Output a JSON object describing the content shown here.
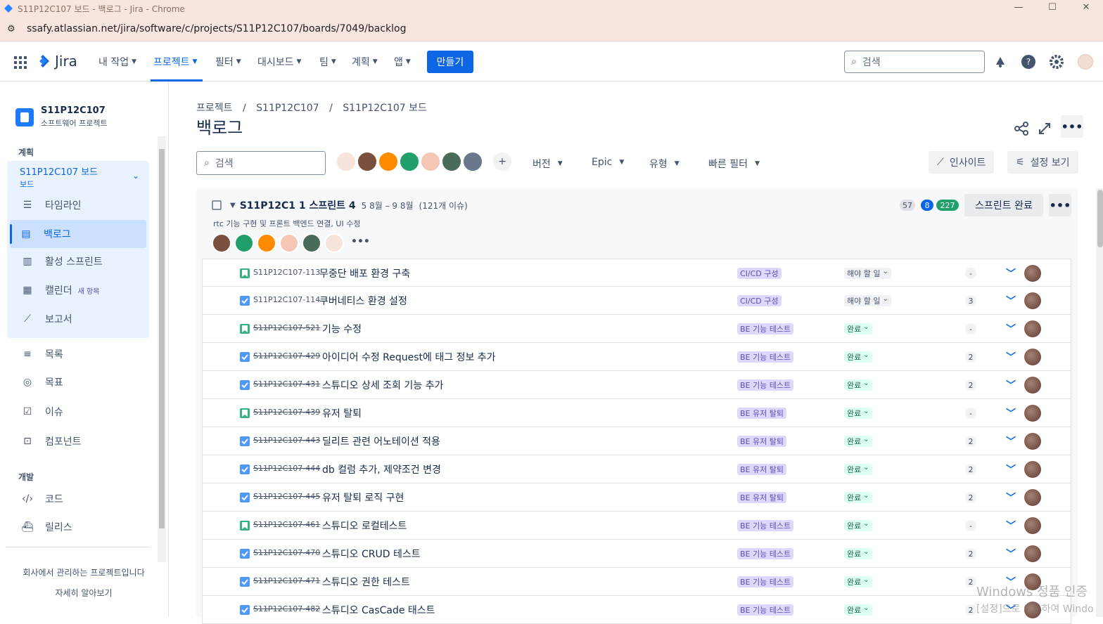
{
  "window": {
    "title": "S11P12C107 보드 - 백로그 - Jira - Chrome"
  },
  "browser": {
    "url": "ssafy.atlassian.net/jira/software/c/projects/S11P12C107/boards/7049/backlog"
  },
  "topnav": {
    "logo": "Jira",
    "items": [
      "내 작업",
      "프로젝트",
      "필터",
      "대시보드",
      "팀",
      "계획",
      "앱"
    ],
    "create_label": "만들기",
    "search_placeholder": "검색"
  },
  "sidebar": {
    "project_name": "S11P12C107",
    "project_type": "소프트웨어 프로젝트",
    "section_plan": "계획",
    "board_name": "S11P12C107 보드",
    "board_sub": "보드",
    "plan_items": [
      "타임라인",
      "백로그",
      "활성 스프린트",
      "캘린더",
      "보고서"
    ],
    "new_tag": "새 항목",
    "other_items": [
      "목록",
      "목표",
      "이슈",
      "컴포넌트"
    ],
    "section_dev": "개발",
    "dev_items": [
      "코드",
      "릴리스"
    ],
    "footer_line1": "회사에서 관리하는 프로젝트입니다",
    "footer_line2": "자세히 알아보기"
  },
  "main": {
    "breadcrumb": [
      "프로젝트",
      "/",
      "S11P12C107",
      "/",
      "S11P12C107 보드"
    ],
    "title": "백로그",
    "search_placeholder": "검색",
    "filters": [
      "버전",
      "Epic",
      "유형",
      "빠른 필터"
    ],
    "insight_label": "인사이트",
    "view_settings_label": "설정 보기"
  },
  "sprint": {
    "name": "S11P12C1 1 스프린트 4",
    "dates": "5 8월 – 9 8월",
    "count": "(121개 이슈)",
    "description": "rtc 기능 구현 및 프론트 백엔드 연결, UI 수정",
    "todo_count": "57",
    "inprogress_count": "8",
    "done_count": "227",
    "complete_label": "스프린트 완료"
  },
  "issues": [
    {
      "key": "S11P12C107-113",
      "type": "story",
      "done": false,
      "summary": "무중단 배포 환경 구축",
      "epic": "CI/CD 구성",
      "status": "해야 할 일",
      "estimate": "-"
    },
    {
      "key": "S11P12C107-114",
      "type": "task",
      "done": false,
      "summary": "쿠버네티스 환경 설정",
      "epic": "CI/CD 구성",
      "status": "해야 할 일",
      "estimate": "3"
    },
    {
      "key": "S11P12C107-521",
      "type": "story",
      "done": true,
      "summary": "기능 수정",
      "epic": "BE 기능 테스트",
      "status": "완료",
      "estimate": "-"
    },
    {
      "key": "S11P12C107-429",
      "type": "task",
      "done": true,
      "summary": "아이디어 수정 Request에 태그 정보 추가",
      "epic": "BE 기능 테스트",
      "status": "완료",
      "estimate": "2"
    },
    {
      "key": "S11P12C107-431",
      "type": "task",
      "done": true,
      "summary": "스튜디오 상세 조회 기능 추가",
      "epic": "BE 기능 테스트",
      "status": "완료",
      "estimate": "2"
    },
    {
      "key": "S11P12C107-439",
      "type": "story",
      "done": true,
      "summary": "유저 탈퇴",
      "epic": "BE 유저 탈퇴",
      "status": "완료",
      "estimate": "-"
    },
    {
      "key": "S11P12C107-443",
      "type": "task",
      "done": true,
      "summary": "딜리트 관련 어노테이션 적용",
      "epic": "BE 유저 탈퇴",
      "status": "완료",
      "estimate": "2"
    },
    {
      "key": "S11P12C107-444",
      "type": "task",
      "done": true,
      "summary": "db 컬럼 추가, 제약조건 변경",
      "epic": "BE 유저 탈퇴",
      "status": "완료",
      "estimate": "2"
    },
    {
      "key": "S11P12C107-445",
      "type": "task",
      "done": true,
      "summary": "유저 탈퇴 로직 구현",
      "epic": "BE 유저 탈퇴",
      "status": "완료",
      "estimate": "2"
    },
    {
      "key": "S11P12C107-461",
      "type": "story",
      "done": true,
      "summary": "스튜디오 로컬테스트",
      "epic": "BE 기능 테스트",
      "status": "완료",
      "estimate": "-"
    },
    {
      "key": "S11P12C107-470",
      "type": "task",
      "done": true,
      "summary": "스튜디오 CRUD 테스트",
      "epic": "BE 기능 테스트",
      "status": "완료",
      "estimate": "2"
    },
    {
      "key": "S11P12C107-471",
      "type": "task",
      "done": true,
      "summary": "스튜디오 권한 테스트",
      "epic": "BE 기능 테스트",
      "status": "완료",
      "estimate": "2"
    },
    {
      "key": "S11P12C107-482",
      "type": "task",
      "done": true,
      "summary": "스튜디오 CasCade 태스트",
      "epic": "BE 기능 테스트",
      "status": "완료",
      "estimate": "2"
    }
  ],
  "watermark": {
    "line1": "Windows 정품 인증",
    "line2": "[설정]으로 이동하여 Windo"
  },
  "colors": {
    "accent": "#0c66e4",
    "epic_bg": "#dfd8fd",
    "done_bg": "#dcfff1"
  }
}
